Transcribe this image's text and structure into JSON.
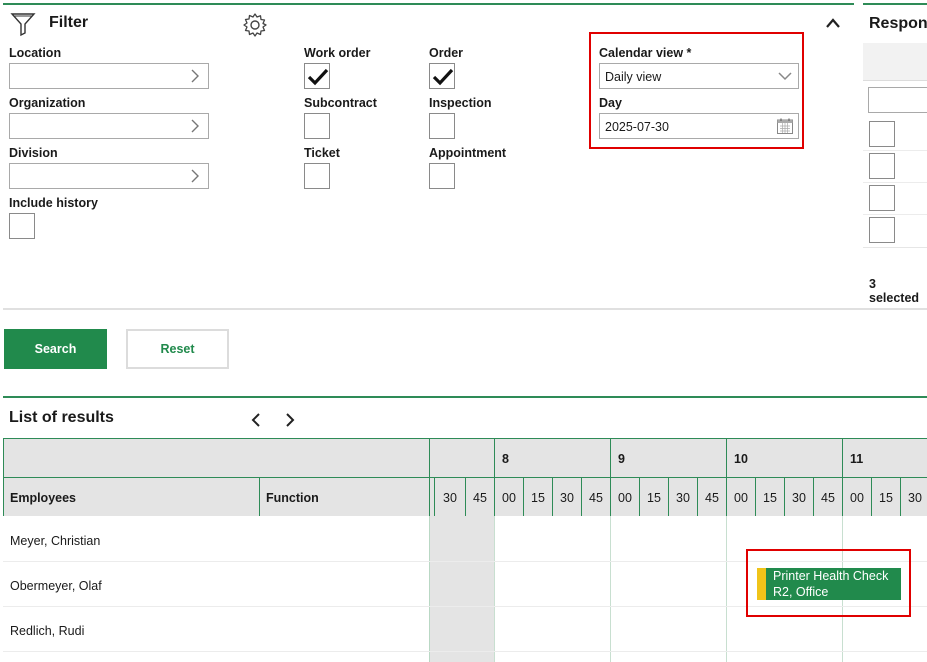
{
  "filter": {
    "title": "Filter",
    "location_label": "Location",
    "organization_label": "Organization",
    "division_label": "Division",
    "include_history_label": "Include history",
    "work_order_label": "Work order",
    "subcontract_label": "Subcontract",
    "ticket_label": "Ticket",
    "order_label": "Order",
    "inspection_label": "Inspection",
    "appointment_label": "Appointment",
    "calendar_view_label": "Calendar view *",
    "calendar_view_value": "Daily view",
    "day_label": "Day",
    "day_value": "2025-07-30",
    "checked": {
      "work_order": true,
      "order": true,
      "subcontract": false,
      "inspection": false,
      "ticket": false,
      "appointment": false,
      "include_history": false
    }
  },
  "responsible": {
    "title": "Respons",
    "selected_text": "3 selected"
  },
  "buttons": {
    "search": "Search",
    "reset": "Reset"
  },
  "results": {
    "title": "List of results",
    "col_employees": "Employees",
    "col_function": "Function",
    "hours": [
      "8",
      "9",
      "10",
      "11"
    ],
    "minutes": [
      "30",
      "45",
      "00",
      "15",
      "30",
      "45",
      "00",
      "15",
      "30",
      "45",
      "00",
      "15",
      "30",
      "45",
      "00",
      "15",
      "30"
    ],
    "employees": [
      "Meyer, Christian",
      "Obermeyer, Olaf",
      "Redlich, Rudi"
    ],
    "appointment": {
      "line1": "Printer Health Check",
      "line2": "R2, Office",
      "color": "#218a4c",
      "accent": "#f0c419"
    }
  },
  "colors": {
    "accent_green": "#2e8b57",
    "button_green": "#218a4c",
    "highlight_red": "#e00000"
  }
}
